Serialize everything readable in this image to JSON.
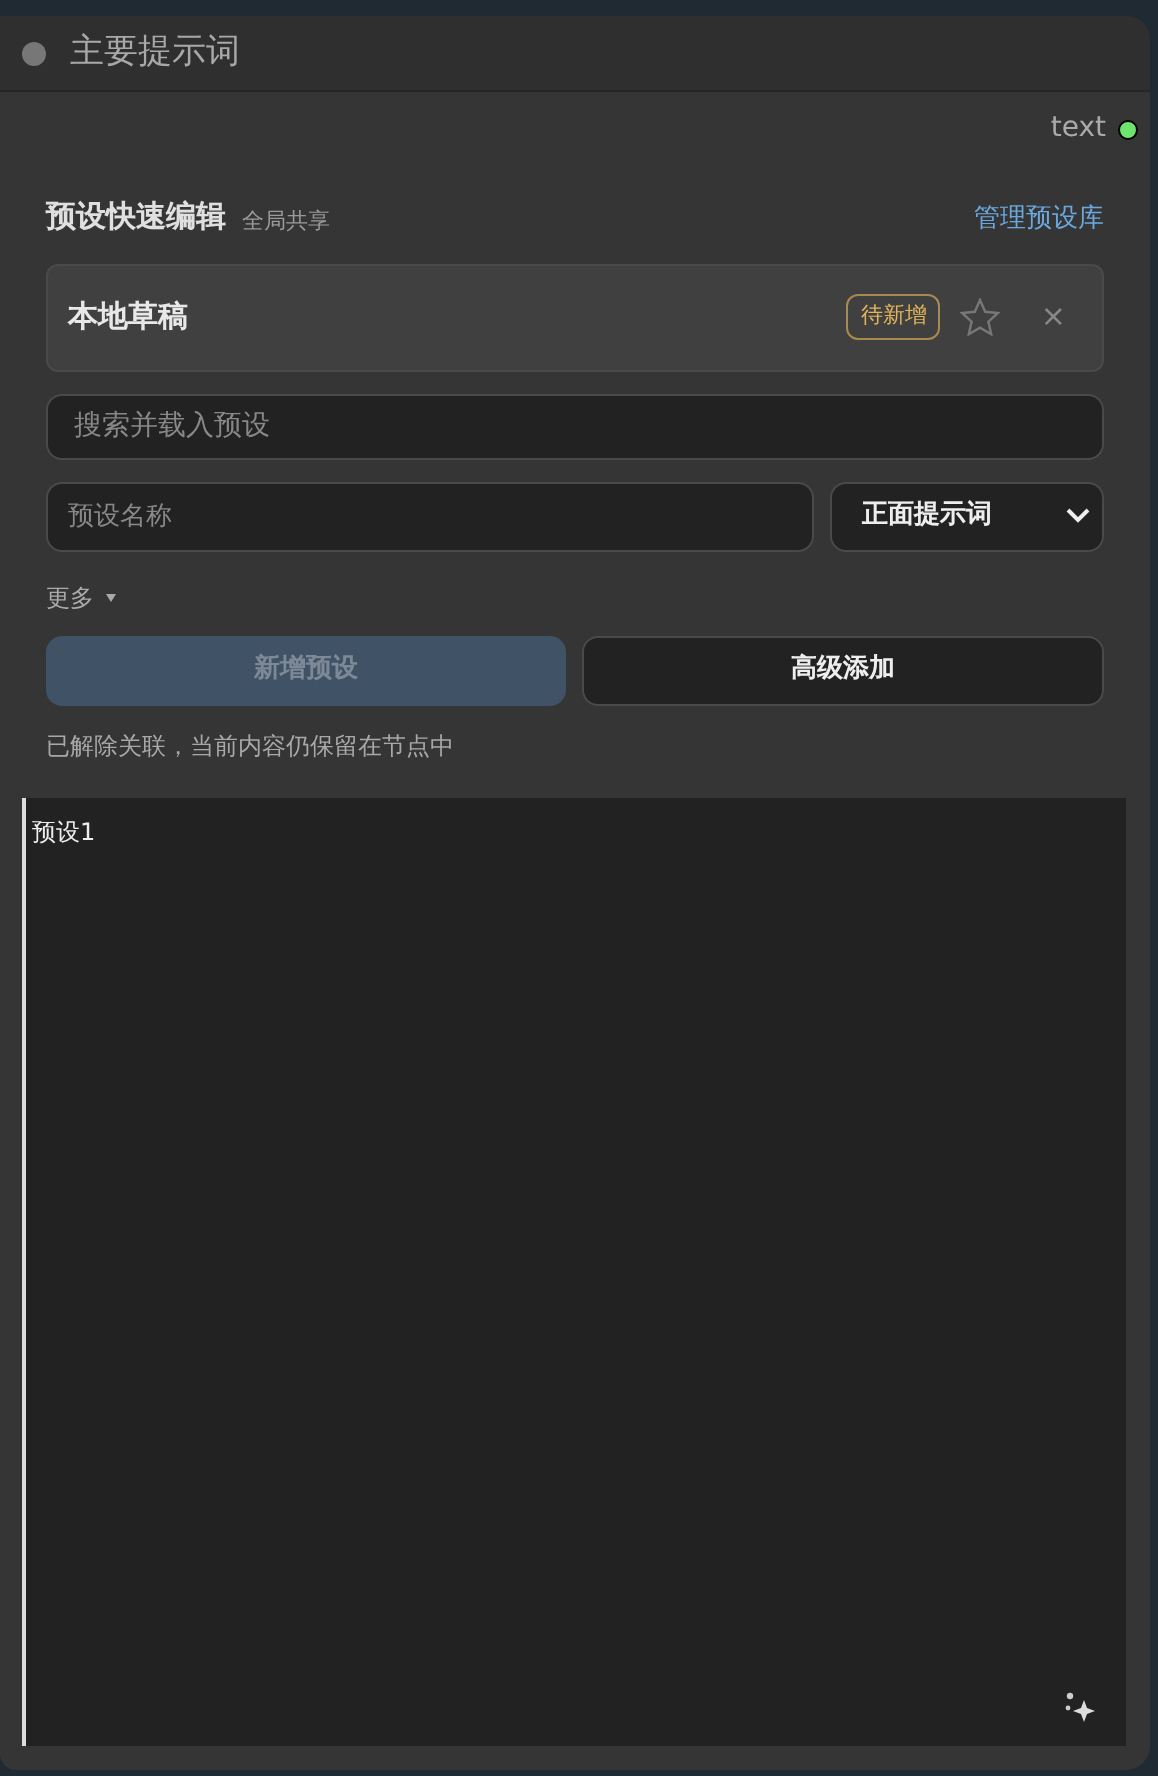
{
  "node": {
    "title": "主要提示词",
    "output": {
      "label": "text",
      "connected": true
    }
  },
  "editor": {
    "title": "预设快速编辑",
    "subtitle": "全局共享",
    "manage_link": "管理预设库",
    "current": {
      "name": "本地草稿",
      "badge": "待新增",
      "starred": false,
      "close": "×"
    },
    "search": {
      "placeholder": "搜索并载入预设"
    },
    "name_field": {
      "placeholder": "预设名称"
    },
    "type_select": {
      "value": "正面提示词"
    },
    "more": {
      "label": "更多",
      "expanded": false
    },
    "buttons": [
      {
        "label": "新增预设",
        "kind": "primary",
        "disabled": true
      },
      {
        "label": "高级添加",
        "kind": "secondary",
        "disabled": false
      }
    ],
    "status": "已解除关联，当前内容仍保留在节点中"
  },
  "textarea": {
    "value": "预设1"
  }
}
